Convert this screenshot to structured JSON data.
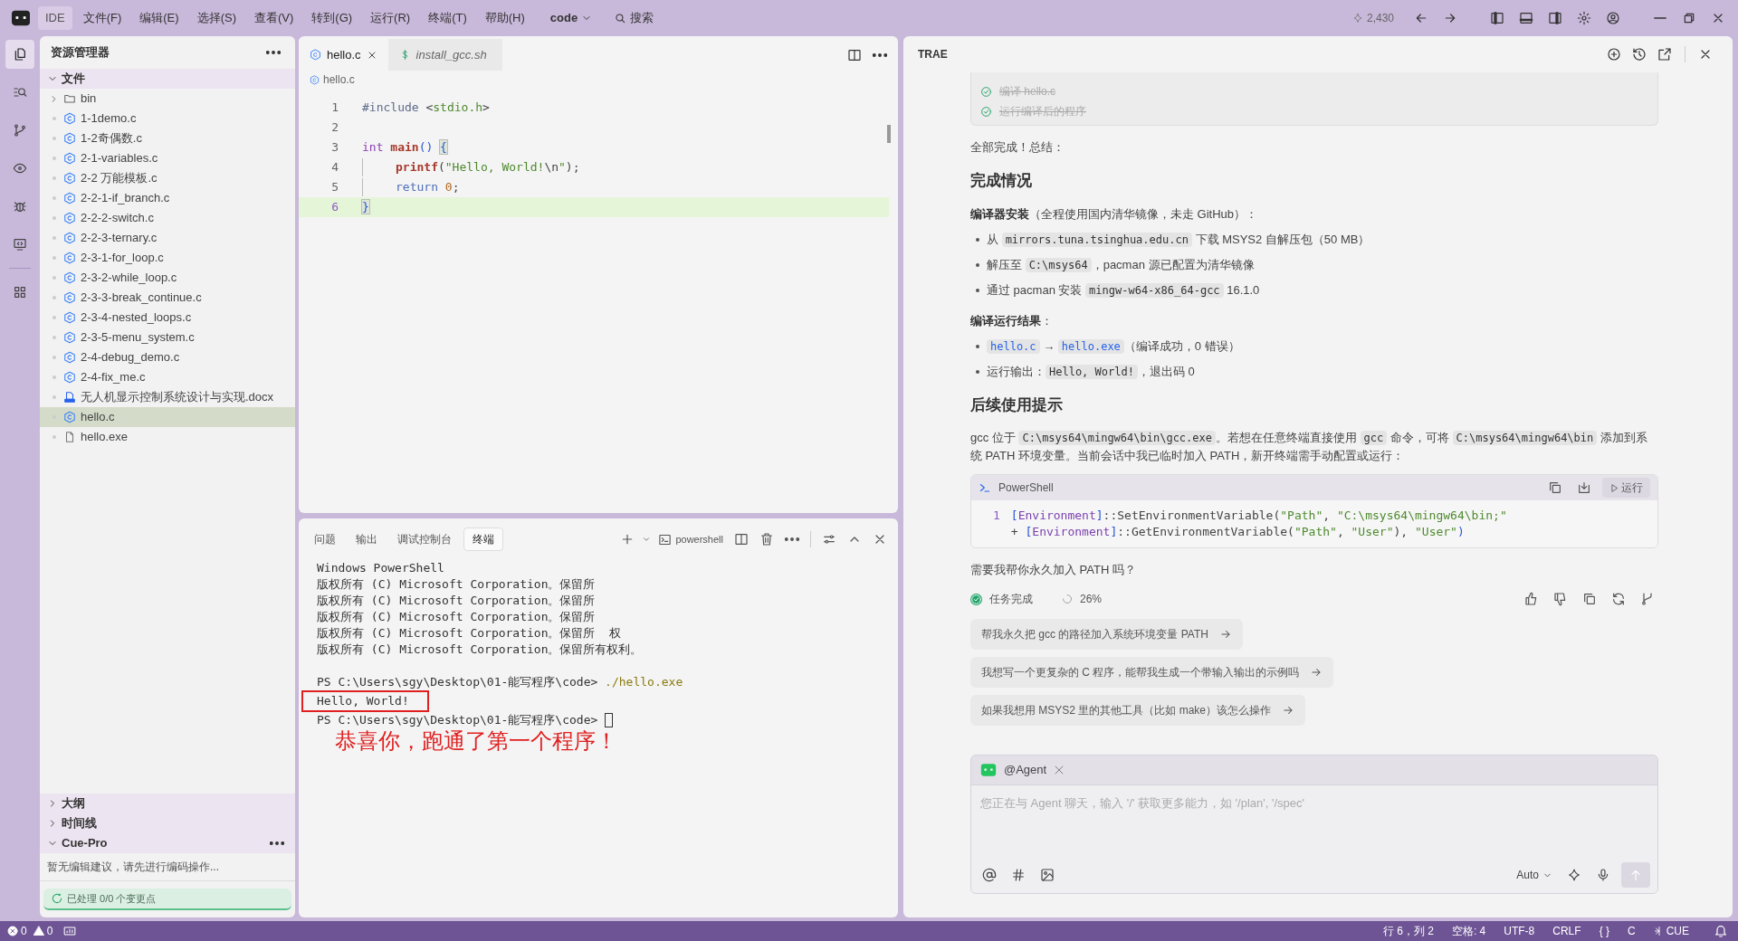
{
  "title_bar": {
    "logo": "IDE",
    "menus": [
      "文件(F)",
      "编辑(E)",
      "选择(S)",
      "查看(V)",
      "转到(G)",
      "运行(R)",
      "终端(T)",
      "帮助(H)"
    ],
    "project": "code",
    "search": "搜索",
    "credits": "2,430"
  },
  "activity_bar": [
    {
      "selected": true
    },
    {
      "selected": false
    },
    {
      "selected": false
    },
    {
      "selected": false
    },
    {
      "selected": false
    },
    {
      "selected": false
    },
    {
      "selected": false
    }
  ],
  "explorer": {
    "title": "资源管理器",
    "section": "文件",
    "expanded": true,
    "items": [
      {
        "label": "bin",
        "kind": "folder",
        "expanded": false,
        "selected": false
      },
      {
        "label": "1-1demo.c",
        "kind": "c",
        "selected": false
      },
      {
        "label": "1-2奇偶数.c",
        "kind": "c",
        "selected": false
      },
      {
        "label": "2-1-variables.c",
        "kind": "c",
        "selected": false
      },
      {
        "label": "2-2 万能模板.c",
        "kind": "c",
        "selected": false
      },
      {
        "label": "2-2-1-if_branch.c",
        "kind": "c",
        "selected": false
      },
      {
        "label": "2-2-2-switch.c",
        "kind": "c",
        "selected": false
      },
      {
        "label": "2-2-3-ternary.c",
        "kind": "c",
        "selected": false
      },
      {
        "label": "2-3-1-for_loop.c",
        "kind": "c",
        "selected": false
      },
      {
        "label": "2-3-2-while_loop.c",
        "kind": "c",
        "selected": false
      },
      {
        "label": "2-3-3-break_continue.c",
        "kind": "c",
        "selected": false
      },
      {
        "label": "2-3-4-nested_loops.c",
        "kind": "c",
        "selected": false
      },
      {
        "label": "2-3-5-menu_system.c",
        "kind": "c",
        "selected": false
      },
      {
        "label": "2-4-debug_demo.c",
        "kind": "c",
        "selected": false
      },
      {
        "label": "2-4-fix_me.c",
        "kind": "c",
        "selected": false
      },
      {
        "label": "无人机显示控制系统设计与实现.docx",
        "kind": "docx",
        "selected": false
      },
      {
        "label": "hello.c",
        "kind": "c",
        "selected": true
      },
      {
        "label": "hello.exe",
        "kind": "file",
        "selected": false
      }
    ]
  },
  "panels": [
    {
      "label": "大纲",
      "expanded": false
    },
    {
      "label": "时间线",
      "expanded": false
    },
    {
      "label": "Cue-Pro",
      "expanded": true,
      "message": "暂无编辑建议，请先进行编码操作...",
      "status": "已处理 0/0 个变更点"
    }
  ],
  "editor": {
    "tabs": [
      {
        "label": "hello.c",
        "kind": "c",
        "selected": true
      },
      {
        "label": "install_gcc.sh",
        "kind": "sh",
        "selected": false
      }
    ],
    "breadcrumb": "hello.c",
    "lines": [
      {
        "number": "1",
        "current": false,
        "tokens": [
          {
            "kind": "preprocessor",
            "text": "#include "
          },
          {
            "kind": "punctuation",
            "text": "<"
          },
          {
            "kind": "string",
            "text": "stdio.h"
          },
          {
            "kind": "punctuation",
            "text": ">"
          }
        ]
      },
      {
        "number": "2",
        "current": false
      },
      {
        "number": "3",
        "current": false,
        "tokens": [
          {
            "kind": "type",
            "text": "int "
          },
          {
            "kind": "function",
            "text": "main"
          },
          {
            "kind": "bracket",
            "text": "() "
          },
          {
            "kind": "brace",
            "text": "{"
          }
        ]
      },
      {
        "number": "4",
        "current": false,
        "indented": true,
        "tokens": [
          {
            "kind": "function",
            "text": "printf"
          },
          {
            "kind": "punctuation",
            "text": "("
          },
          {
            "kind": "string",
            "text": "\"Hello, World!"
          },
          {
            "kind": "punctuation",
            "text": "\\n"
          },
          {
            "kind": "string",
            "text": "\""
          },
          {
            "kind": "punctuation",
            "text": ");"
          }
        ]
      },
      {
        "number": "5",
        "current": false,
        "indented": true,
        "tokens": [
          {
            "kind": "keyword",
            "text": "return "
          },
          {
            "kind": "number",
            "text": "0"
          },
          {
            "kind": "punctuation",
            "text": ";"
          }
        ]
      },
      {
        "number": "6",
        "current": true,
        "tokens": [
          {
            "kind": "brace",
            "text": "}"
          }
        ]
      }
    ]
  },
  "terminal": {
    "tabs": [
      {
        "label": "问题",
        "selected": false
      },
      {
        "label": "输出",
        "selected": false
      },
      {
        "label": "调试控制台",
        "selected": false
      },
      {
        "label": "终端",
        "selected": true
      }
    ],
    "shell": "powershell",
    "lines": [
      {
        "kind": "text",
        "text": "Windows PowerShell"
      },
      {
        "kind": "text",
        "text": "版权所有 (C) Microsoft Corporation。保留所"
      },
      {
        "kind": "text",
        "text": "版权所有 (C) Microsoft Corporation。保留所"
      },
      {
        "kind": "text",
        "text": "版权所有 (C) Microsoft Corporation。保留所"
      },
      {
        "kind": "text",
        "text": "版权所有 (C) Microsoft Corporation。保留所  权"
      },
      {
        "kind": "text",
        "text": "版权所有 (C) Microsoft Corporation。保留所有权利。"
      },
      {
        "kind": "blank"
      },
      {
        "kind": "prompt",
        "prompt": "PS C:\\Users\\sgy\\Desktop\\01-能写程序\\code> ",
        "command": "./hello.exe",
        "cursor": false
      },
      {
        "kind": "output",
        "text": "Hello, World!",
        "boxed": true
      },
      {
        "kind": "prompt",
        "prompt": "PS C:\\Users\\sgy\\Desktop\\01-能写程序\\code> ",
        "cursor": true
      }
    ],
    "annotation": "恭喜你，跑通了第一个程序！"
  },
  "chat": {
    "title": "TRAE",
    "tasks": [
      {
        "label": "编译 hello.c",
        "done": true
      },
      {
        "label": "运行编译后的程序",
        "done": true
      }
    ],
    "blocks": [
      {
        "kind": "p",
        "segments": [
          {
            "kind": "plain",
            "text": "全部完成！总结："
          }
        ]
      },
      {
        "kind": "h",
        "text": "完成情况"
      },
      {
        "kind": "p",
        "segments": [
          {
            "kind": "bold",
            "text": "编译器安装"
          },
          {
            "kind": "plain",
            "text": "（全程使用国内清华镜像，未走 GitHub）："
          }
        ]
      },
      {
        "kind": "ul",
        "items": [
          [
            {
              "kind": "plain",
              "text": "从 "
            },
            {
              "kind": "code",
              "text": "mirrors.tuna.tsinghua.edu.cn"
            },
            {
              "kind": "plain",
              "text": " 下载 MSYS2 自解压包（50 MB）"
            }
          ],
          [
            {
              "kind": "plain",
              "text": "解压至 "
            },
            {
              "kind": "code",
              "text": "C:\\msys64"
            },
            {
              "kind": "plain",
              "text": "，pacman 源已配置为清华镜像"
            }
          ],
          [
            {
              "kind": "plain",
              "text": "通过 pacman 安装 "
            },
            {
              "kind": "code",
              "text": "mingw-w64-x86_64-gcc"
            },
            {
              "kind": "plain",
              "text": " 16.1.0"
            }
          ]
        ]
      },
      {
        "kind": "p",
        "segments": [
          {
            "kind": "bold",
            "text": "编译运行结果"
          },
          {
            "kind": "plain",
            "text": "："
          }
        ]
      },
      {
        "kind": "ul",
        "items": [
          [
            {
              "kind": "link",
              "text": "hello.c"
            },
            {
              "kind": "plain",
              "text": " → "
            },
            {
              "kind": "link",
              "text": "hello.exe"
            },
            {
              "kind": "plain",
              "text": "（编译成功，0 错误）"
            }
          ],
          [
            {
              "kind": "plain",
              "text": "运行输出："
            },
            {
              "kind": "code",
              "text": "Hello, World!"
            },
            {
              "kind": "plain",
              "text": "，退出码 0"
            }
          ]
        ]
      },
      {
        "kind": "h",
        "text": "后续使用提示"
      },
      {
        "kind": "p",
        "segments": [
          {
            "kind": "plain",
            "text": "gcc 位于 "
          },
          {
            "kind": "code",
            "text": "C:\\msys64\\mingw64\\bin\\gcc.exe"
          },
          {
            "kind": "plain",
            "text": "。若想在任意终端直接使用 "
          },
          {
            "kind": "code",
            "text": "gcc"
          },
          {
            "kind": "plain",
            "text": " 命令，可将 "
          },
          {
            "kind": "code",
            "text": "C:\\msys64\\mingw64\\bin"
          },
          {
            "kind": "plain",
            "text": " 添加到系统 PATH 环境变量。当前会话中我已临时加入 PATH，新开终端需手动配置或运行："
          }
        ]
      },
      {
        "kind": "code",
        "language": "PowerShell",
        "run": "运行",
        "line_number": "1",
        "tokens": [
          {
            "kind": "bracket",
            "text": "["
          },
          {
            "kind": "class",
            "text": "Environment"
          },
          {
            "kind": "bracket",
            "text": "]"
          },
          {
            "kind": "punctuation",
            "text": "::SetEnvironmentVariable("
          },
          {
            "kind": "string",
            "text": "\"Path\""
          },
          {
            "kind": "punctuation",
            "text": ", "
          },
          {
            "kind": "string",
            "text": "\"C:\\msys64\\mingw64\\bin;\""
          },
          {
            "kind": "punctuation",
            "text": " + "
          },
          {
            "kind": "bracket",
            "text": "["
          },
          {
            "kind": "class",
            "text": "Environment"
          },
          {
            "kind": "bracket",
            "text": "]"
          },
          {
            "kind": "punctuation",
            "text": "::GetEnvironmentVariable("
          },
          {
            "kind": "string",
            "text": "\"Path\""
          },
          {
            "kind": "punctuation",
            "text": ", "
          },
          {
            "kind": "string",
            "text": "\"User\""
          },
          {
            "kind": "punctuation",
            "text": "), "
          },
          {
            "kind": "string",
            "text": "\"User\""
          },
          {
            "kind": "bracket",
            "text": ")"
          }
        ]
      },
      {
        "kind": "p",
        "segments": [
          {
            "kind": "plain",
            "text": "需要我帮你永久加入 PATH 吗？"
          }
        ]
      }
    ],
    "status": "任务完成",
    "progress": "26%",
    "suggestions": [
      "帮我永久把 gcc 的路径加入系统环境变量 PATH",
      "我想写一个更复杂的 C 程序，能帮我生成一个带输入输出的示例吗",
      "如果我想用 MSYS2 里的其他工具（比如 make）该怎么操作"
    ],
    "input": {
      "agent": "@Agent",
      "placeholder": "您正在与 Agent 聊天，输入 '/' 获取更多能力，如 '/plan', '/spec'",
      "model": "Auto"
    }
  },
  "status_bar": {
    "errors": "0",
    "warnings": "0",
    "items": [
      "行 6，列 2",
      "空格: 4",
      "UTF-8",
      "CRLF",
      "{ }",
      "C"
    ],
    "cue": "CUE"
  }
}
